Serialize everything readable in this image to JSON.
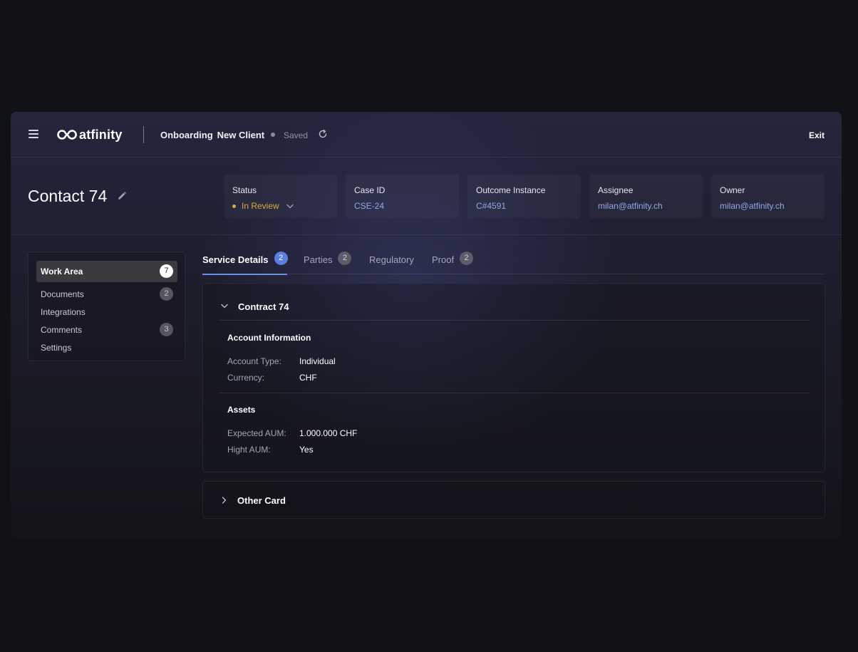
{
  "topbar": {
    "menu_icon": "hamburger-menu-icon",
    "logo_text": "atfinity",
    "breadcrumb": [
      "Onboarding",
      "New Client"
    ],
    "saved_label": "Saved",
    "refresh_icon": "refresh-icon",
    "exit_label": "Exit"
  },
  "header": {
    "title": "Contact 74",
    "edit_icon": "pencil-icon",
    "cards": [
      {
        "label": "Status",
        "value": "In Review"
      },
      {
        "label": "Case ID",
        "value": "CSE-24"
      },
      {
        "label": "Outcome Instance",
        "value": "C#4591"
      },
      {
        "label": "Assignee",
        "value": "milan@atfinity.ch"
      },
      {
        "label": "Owner",
        "value": "milan@atfinity.ch"
      }
    ]
  },
  "sidebar": {
    "items": [
      {
        "label": "Work Area",
        "badge": "7"
      },
      {
        "label": "Documents",
        "badge": "2"
      },
      {
        "label": "Integrations"
      },
      {
        "label": "Comments",
        "badge": "3"
      },
      {
        "label": "Settings"
      }
    ]
  },
  "tabs": [
    {
      "label": "Service Details",
      "badge": "2"
    },
    {
      "label": "Parties",
      "badge": "2"
    },
    {
      "label": "Regulatory"
    },
    {
      "label": "Proof",
      "badge": "2"
    }
  ],
  "card": {
    "title": "Contract 74",
    "sections": [
      {
        "title": "Account Information",
        "rows": [
          {
            "label": "Account Type:",
            "value": "Individual"
          },
          {
            "label": "Currency:",
            "value": "CHF"
          }
        ]
      },
      {
        "title": "Assets",
        "rows": [
          {
            "label": "Expected AUM:",
            "value": "1.000.000 CHF"
          },
          {
            "label": "Hight AUM:",
            "value": "Yes"
          }
        ]
      }
    ]
  },
  "card2": {
    "title": "Other Card"
  },
  "colors": {
    "accent": "#5b7fe0",
    "status": "#e0a83f",
    "link": "#8fa8e8"
  }
}
